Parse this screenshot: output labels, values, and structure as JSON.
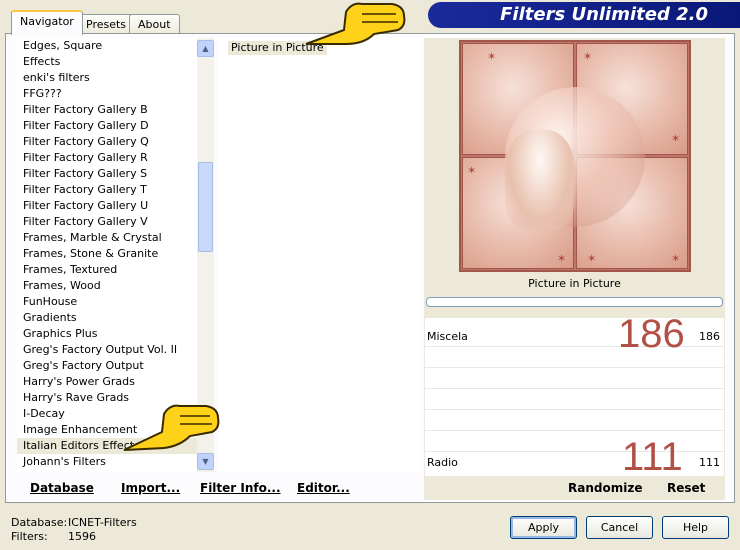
{
  "banner": {
    "title": "Filters Unlimited 2.0"
  },
  "tabs": [
    {
      "label": "Navigator"
    },
    {
      "label": "Presets"
    },
    {
      "label": "About"
    }
  ],
  "categories": [
    "Edges, Square",
    "Effects",
    "enki's filters",
    "FFG???",
    "Filter Factory Gallery B",
    "Filter Factory Gallery D",
    "Filter Factory Gallery Q",
    "Filter Factory Gallery R",
    "Filter Factory Gallery S",
    "Filter Factory Gallery T",
    "Filter Factory Gallery U",
    "Filter Factory Gallery V",
    "Frames, Marble & Crystal",
    "Frames, Stone & Granite",
    "Frames, Textured",
    "Frames, Wood",
    "FunHouse",
    "Gradients",
    "Graphics Plus",
    "Greg's Factory Output Vol. II",
    "Greg's Factory Output",
    "Harry's Power Grads",
    "Harry's Rave Grads",
    "I-Decay",
    "Image Enhancement",
    "Italian Editors Effect",
    "Johann's Filters"
  ],
  "selected_category": "Italian Editors Effect",
  "filters": {
    "selected": "Picture in Picture"
  },
  "preview": {
    "caption": "Picture in Picture"
  },
  "params": [
    {
      "label": "Miscela",
      "value": "186",
      "big": "186"
    },
    {
      "label": "Radio",
      "value": "111",
      "big": "111"
    }
  ],
  "toolbar": {
    "database": "Database",
    "import": "Import...",
    "filter_info": "Filter Info...",
    "editor": "Editor...",
    "randomize": "Randomize",
    "reset": "Reset"
  },
  "footer": {
    "database_label": "Database:",
    "database_value": "ICNET-Filters",
    "filters_label": "Filters:",
    "filters_value": "1596"
  },
  "buttons": {
    "apply": "Apply",
    "cancel": "Cancel",
    "help": "Help"
  },
  "colors": {
    "banner": "#0a1878",
    "accent_value": "#b25045",
    "preview_frame": "#c0766a"
  }
}
